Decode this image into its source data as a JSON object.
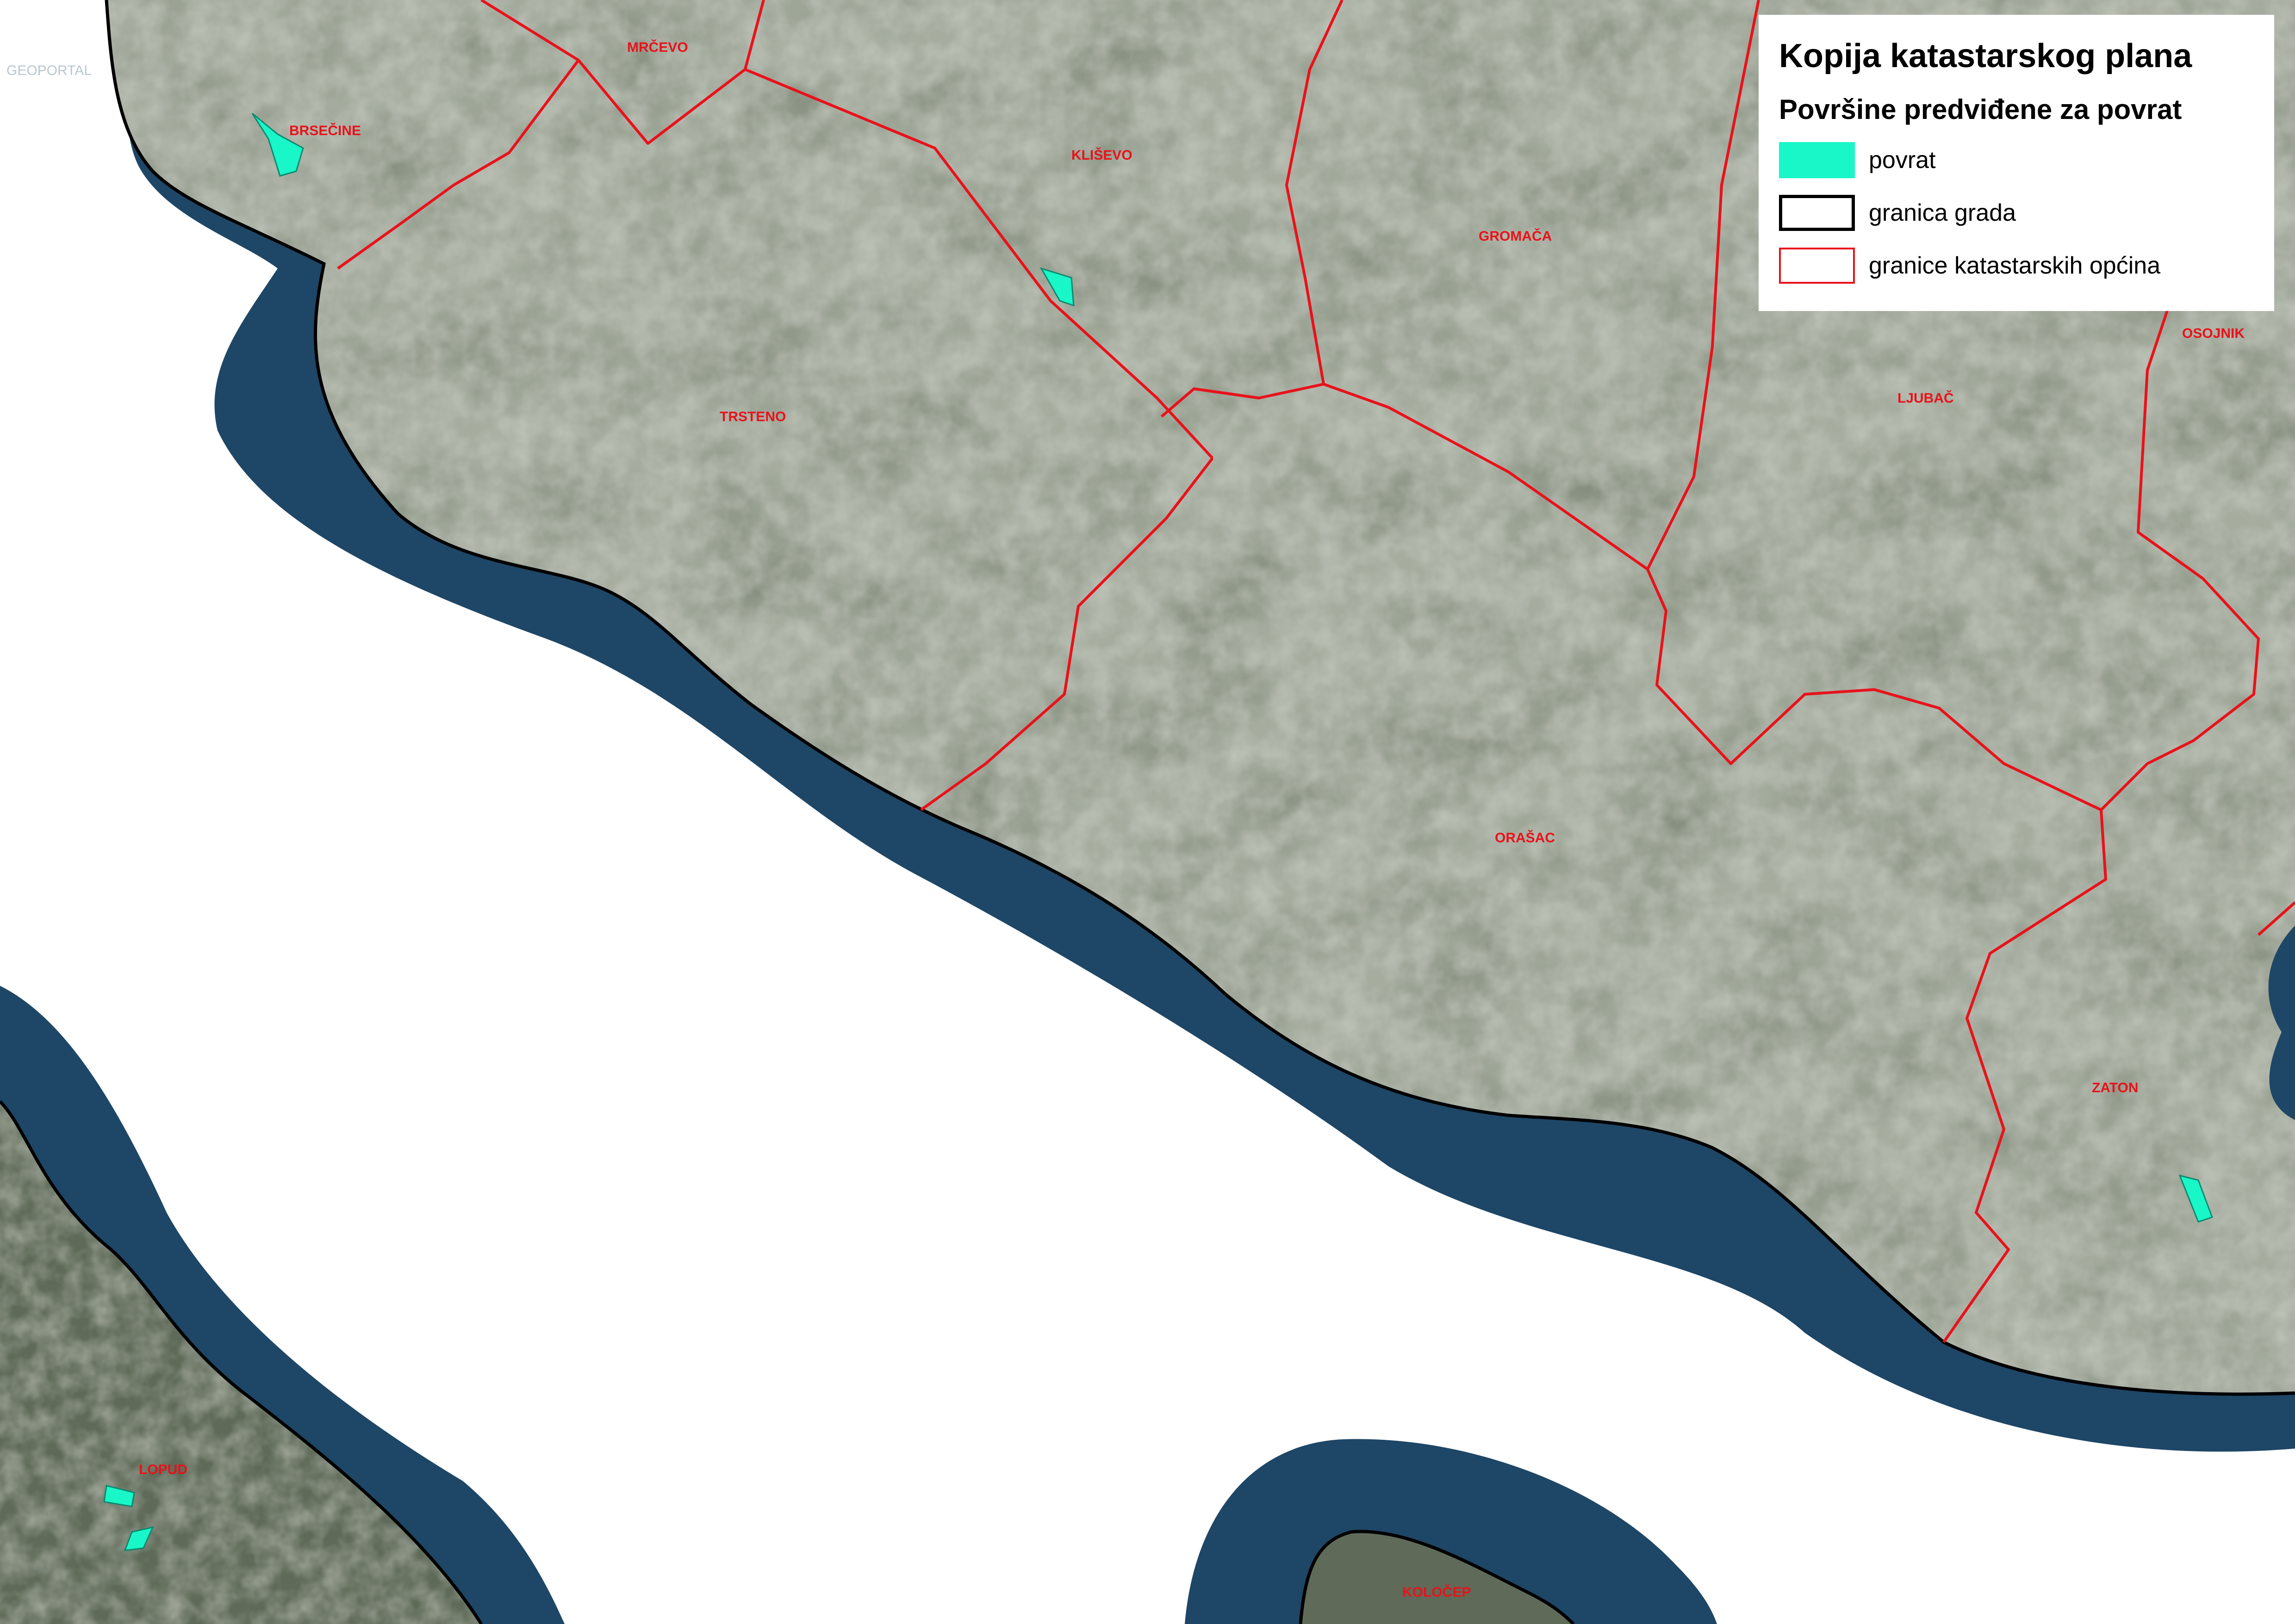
{
  "colors": {
    "sea": "#1e4666",
    "land": "#5f6a58",
    "land_light": "#9aa090",
    "povrat_fill": "#19f7c9",
    "city_border": "#000000",
    "cadastral_border": "#e8121b"
  },
  "watermark": "GEOPORTAL",
  "legend": {
    "title": "Kopija katastarskog plana",
    "subtitle": "Površine predviđene za povrat",
    "items": [
      {
        "label": "povrat",
        "icon": "teal-fill-swatch"
      },
      {
        "label": "granica grada",
        "icon": "black-outline-swatch"
      },
      {
        "label": "granice katastarskih općina",
        "icon": "red-outline-swatch"
      }
    ]
  },
  "places": {
    "mrcevo": "MRČEVO",
    "brsecine": "BRSEČINE",
    "klisevo": "KLIŠEVO",
    "gromaca": "GROMAČA",
    "osojnik": "OSOJNIK",
    "ljubac": "LJUBAČ",
    "trsteno": "TRSTENO",
    "orasac": "ORAŠAC",
    "zaton": "ZATON",
    "lopud": "LOPUD",
    "kolocep": "KOLOČEP"
  }
}
